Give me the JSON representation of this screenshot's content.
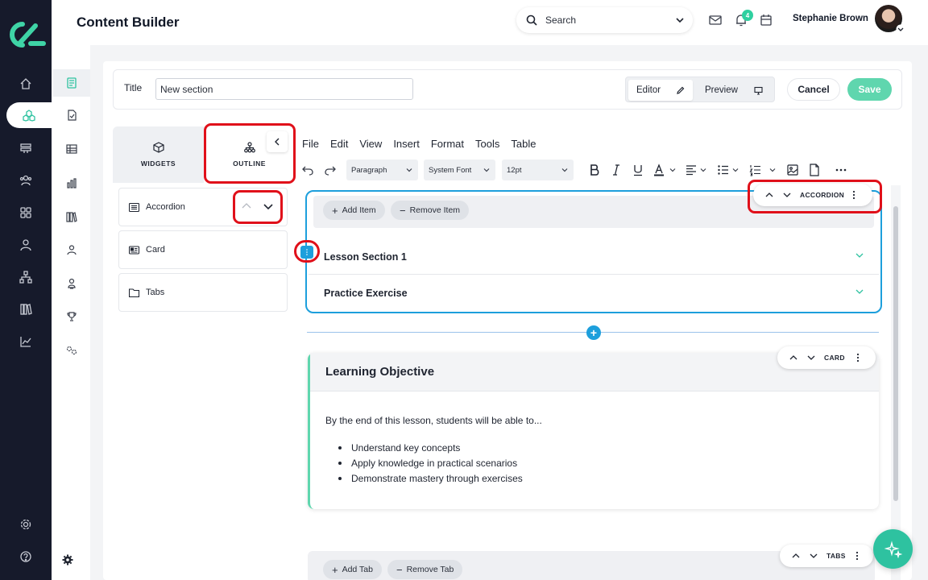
{
  "header": {
    "page_title": "Content Builder",
    "search_placeholder": "Search",
    "notification_count": "4",
    "user_name": "Stephanie Brown"
  },
  "title_bar": {
    "label": "Title",
    "value": "New section",
    "editor_label": "Editor",
    "preview_label": "Preview",
    "cancel_label": "Cancel",
    "save_label": "Save"
  },
  "widget_panel": {
    "tabs": [
      {
        "label": "WIDGETS"
      },
      {
        "label": "OUTLINE"
      }
    ],
    "items": [
      {
        "label": "Accordion"
      },
      {
        "label": "Card"
      },
      {
        "label": "Tabs"
      }
    ]
  },
  "editor": {
    "menu": [
      "File",
      "Edit",
      "View",
      "Insert",
      "Format",
      "Tools",
      "Table"
    ],
    "block_format": "Paragraph",
    "font_family": "System Font",
    "font_size": "12pt"
  },
  "accordion_block": {
    "type_label": "ACCORDION",
    "add_label": "Add Item",
    "remove_label": "Remove Item",
    "items": [
      {
        "label": "Lesson Section 1"
      },
      {
        "label": "Practice Exercise"
      }
    ]
  },
  "card_block": {
    "type_label": "CARD",
    "title": "Learning Objective",
    "intro": "By the end of this lesson, students will be able to...",
    "bullets": [
      "Understand key concepts",
      "Apply knowledge in practical scenarios",
      "Demonstrate mastery through exercises"
    ]
  },
  "tabs_block": {
    "type_label": "TABS",
    "add_label": "Add Tab",
    "remove_label": "Remove Tab"
  },
  "colors": {
    "accent_green": "#5fd6ae",
    "accent_blue": "#1d9fdc",
    "rail_dark": "#161a2b",
    "highlight_red": "#e0101a"
  }
}
